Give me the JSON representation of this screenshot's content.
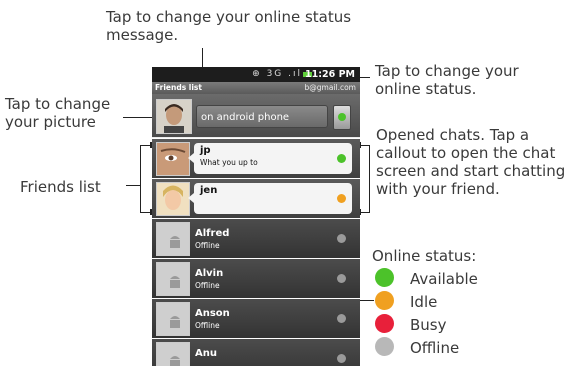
{
  "annotations": {
    "status_message": "Tap to change your online status message.",
    "online_status": "Tap to change your online status.",
    "picture": "Tap to change your picture",
    "friends_list": "Friends list",
    "opened_chats": "Opened chats. Tap a callout to open the chat screen and start chatting with your friend."
  },
  "statusbar": {
    "icons": "⊕ 3G .ıl",
    "time": "11:26 PM"
  },
  "titlebar": {
    "title": "Friends list",
    "account": "b@gmail.com"
  },
  "header": {
    "status_message": "on android phone"
  },
  "chats": [
    {
      "name": "jp",
      "message": "What you up to",
      "status": "available"
    },
    {
      "name": "jen",
      "message": "",
      "status": "idle"
    }
  ],
  "friends": [
    {
      "name": "Alfred",
      "status_text": "Offline"
    },
    {
      "name": "Alvin",
      "status_text": "Offline"
    },
    {
      "name": "Anson",
      "status_text": "Offline"
    },
    {
      "name": "Anu",
      "status_text": ""
    }
  ],
  "legend": {
    "title": "Online status:",
    "items": [
      {
        "label": "Available",
        "color": "#4cc22a"
      },
      {
        "label": "Idle",
        "color": "#f0a020"
      },
      {
        "label": "Busy",
        "color": "#e8203a"
      },
      {
        "label": "Offline",
        "color": "#b8b8b8"
      }
    ]
  }
}
